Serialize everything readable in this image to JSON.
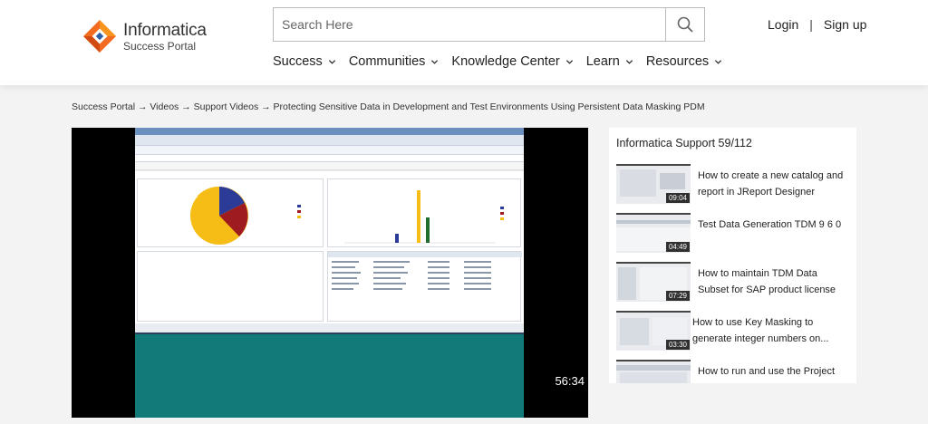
{
  "brand": {
    "name": "Informatica",
    "subtitle": "Success Portal"
  },
  "search": {
    "placeholder": "Search Here"
  },
  "auth": {
    "login": "Login",
    "separator": "|",
    "signup": "Sign up"
  },
  "nav": [
    "Success",
    "Communities",
    "Knowledge Center",
    "Learn",
    "Resources"
  ],
  "breadcrumb": "Success Portal → Videos → Support Videos → Protecting Sensitive Data in Development and Test Environments Using Persistent Data Masking PDM",
  "video": {
    "duration": "56:34"
  },
  "sidebar": {
    "title": "Informatica Support 59/112",
    "items": [
      {
        "title": "How to create a new catalog and report in JReport Designer",
        "duration": "09:04"
      },
      {
        "title": "Test Data Generation TDM 9 6 0",
        "duration": "04:49"
      },
      {
        "title": "How to maintain TDM Data Subset for SAP product license",
        "duration": "07:29"
      },
      {
        "title": "How to use Key Masking to generate integer numbers on...",
        "duration": "03:30"
      },
      {
        "title": "How to run and use the Project",
        "duration": ""
      }
    ]
  },
  "colors": {
    "brand_orange": "#f26b21",
    "teal": "#137a7a"
  }
}
